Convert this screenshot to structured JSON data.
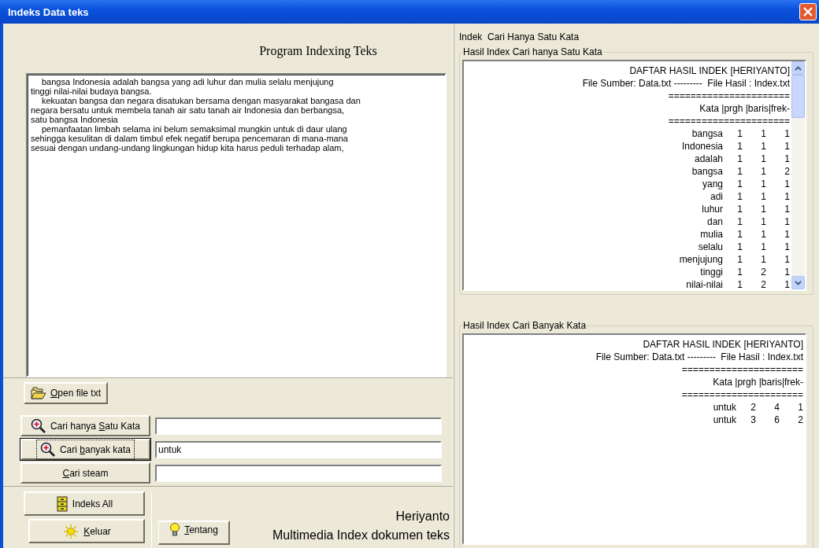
{
  "window": {
    "title": "Indeks Data teks"
  },
  "heading": "Program Indexing Teks",
  "document_lines": [
    {
      "text": "bangsa Indonesia adalah bangsa yang adi luhur dan mulia selalu menjujung",
      "indent": true
    },
    {
      "text": "tinggi nilai-nilai budaya bangsa.",
      "indent": false
    },
    {
      "text": "kekuatan bangsa dan negara disatukan bersama dengan masyarakat bangasa dan",
      "indent": true
    },
    {
      "text": "negara bersatu untuk membela tanah air satu tanah air Indonesia dan berbangsa,",
      "indent": false
    },
    {
      "text": "satu bangsa Indonesia",
      "indent": false
    },
    {
      "text": "pemanfaatan limbah selama ini belum semaksimal mungkin untuk di daur ulang",
      "indent": true
    },
    {
      "text": "sehingga kesulitan di dalam timbul efek negatif berupa pencemaran di mana-mana",
      "indent": false
    },
    {
      "text": "sesuai dengan undang-undang lingkungan hidup kita harus peduli terhadap alam,",
      "indent": false
    }
  ],
  "open_button": {
    "kind": "open",
    "key": "O",
    "post": "pen file txt",
    "focused": false
  },
  "search_rows": [
    {
      "button": {
        "kind": "search",
        "pre": "Cari hanya ",
        "key": "S",
        "post": "atu Kata",
        "focused": false
      },
      "field": {}
    },
    {
      "button": {
        "kind": "search",
        "pre": "Cari ",
        "key": "b",
        "post": "anyak kata",
        "focused": true
      },
      "field": {
        "value": "untuk"
      }
    },
    {
      "button": {
        "kind": "plain",
        "key": "C",
        "post": "ari steam",
        "focused": false
      },
      "field": {}
    }
  ],
  "bottom_buttons": [
    {
      "kind": "index",
      "pre": "Indeks All",
      "focused": false
    },
    {
      "kind": "exit",
      "key": "K",
      "post": "eluar",
      "focused": false
    }
  ],
  "about_button": {
    "kind": "about",
    "key": "T",
    "post": "entang",
    "focused": false
  },
  "credits": [
    "Heriyanto",
    "Multimedia Index dokumen teks"
  ],
  "right_caption": "Indek  Cari Hanya Satu Kata",
  "single_index": {
    "group_title": "Hasil Index Cari hanya Satu Kata",
    "header_lines": [
      "DAFTAR HASIL INDEK [HERIYANTO]",
      "File Sumber: Data.txt ---------  File Hasil : Index.txt",
      "======================",
      "Kata |prgh |baris|frek-",
      "======================"
    ],
    "rows": [
      {
        "word": "bangsa",
        "prgh": "1",
        "baris": "1",
        "frek": "1"
      },
      {
        "word": "Indonesia",
        "prgh": "1",
        "baris": "1",
        "frek": "1"
      },
      {
        "word": "adalah",
        "prgh": "1",
        "baris": "1",
        "frek": "1"
      },
      {
        "word": "bangsa",
        "prgh": "1",
        "baris": "1",
        "frek": "2"
      },
      {
        "word": "yang",
        "prgh": "1",
        "baris": "1",
        "frek": "1"
      },
      {
        "word": "adi",
        "prgh": "1",
        "baris": "1",
        "frek": "1"
      },
      {
        "word": "luhur",
        "prgh": "1",
        "baris": "1",
        "frek": "1"
      },
      {
        "word": "dan",
        "prgh": "1",
        "baris": "1",
        "frek": "1"
      },
      {
        "word": "mulia",
        "prgh": "1",
        "baris": "1",
        "frek": "1"
      },
      {
        "word": "selalu",
        "prgh": "1",
        "baris": "1",
        "frek": "1"
      },
      {
        "word": "menjujung",
        "prgh": "1",
        "baris": "1",
        "frek": "1"
      },
      {
        "word": "tinggi",
        "prgh": "1",
        "baris": "2",
        "frek": "1"
      },
      {
        "word": "nilai-nilai",
        "prgh": "1",
        "baris": "2",
        "frek": "1"
      }
    ]
  },
  "multi_index": {
    "group_title": "Hasil Index Cari Banyak Kata",
    "header_lines": [
      "DAFTAR HASIL INDEK [HERIYANTO]",
      "File Sumber: Data.txt ---------  File Hasil : Index.txt",
      "======================",
      "Kata |prgh |baris|frek-",
      "======================"
    ],
    "rows": [
      {
        "word": "untuk",
        "prgh": "2",
        "baris": "4",
        "frek": "1"
      },
      {
        "word": "untuk",
        "prgh": "3",
        "baris": "6",
        "frek": "2"
      }
    ]
  }
}
